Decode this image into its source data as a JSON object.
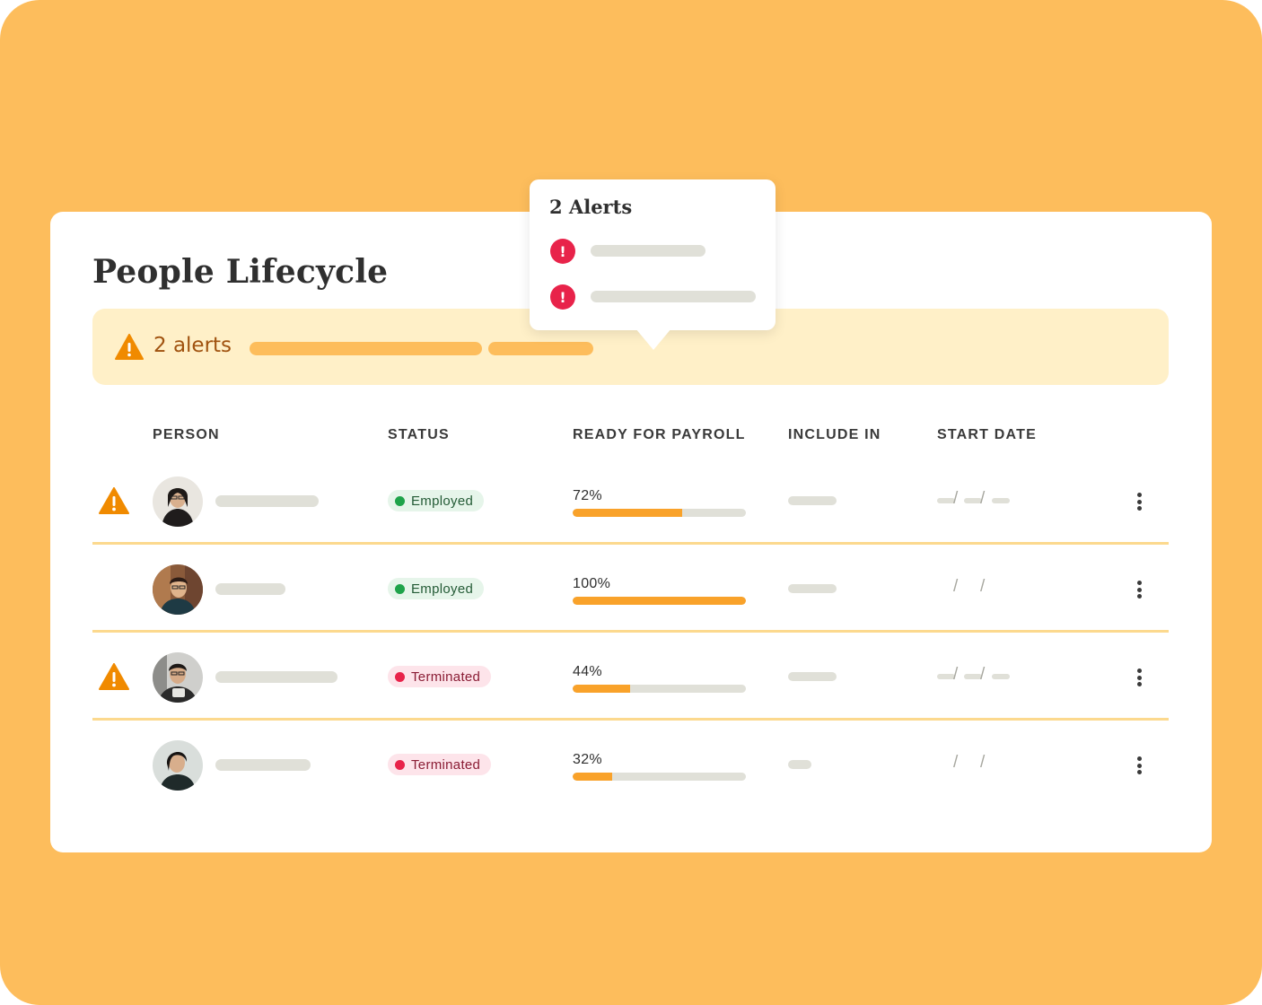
{
  "page": {
    "title": "People Lifecycle"
  },
  "alert_banner": {
    "icon": "warning-icon",
    "text": "2 alerts"
  },
  "popover": {
    "title": "2 Alerts",
    "items": [
      {
        "icon": "error-icon"
      },
      {
        "icon": "error-icon"
      }
    ]
  },
  "table": {
    "headers": [
      "PERSON",
      "STATUS",
      "READY FOR PAYROLL",
      "INCLUDE IN",
      "START DATE"
    ],
    "rows": [
      {
        "alert": true,
        "status": "Employed",
        "status_tone": "green",
        "payroll_label": "72%",
        "payroll_fraction": 0.63,
        "date": "—/—/—"
      },
      {
        "alert": false,
        "status": "Employed",
        "status_tone": "green",
        "payroll_label": "100%",
        "payroll_fraction": 1.0,
        "date": "/ /"
      },
      {
        "alert": true,
        "status": "Terminated",
        "status_tone": "red",
        "payroll_label": "44%",
        "payroll_fraction": 0.33,
        "date": "—/—/—"
      },
      {
        "alert": false,
        "status": "Terminated",
        "status_tone": "red",
        "payroll_label": "32%",
        "payroll_fraction": 0.23,
        "date": "/ /"
      }
    ]
  },
  "colors": {
    "background": "#fdbd5c",
    "banner": "#fff0c8",
    "accent_orange": "#f9a22a",
    "warning_orange": "#f08a00",
    "error_red": "#e8234a",
    "employed_green": "#1fa34a"
  }
}
